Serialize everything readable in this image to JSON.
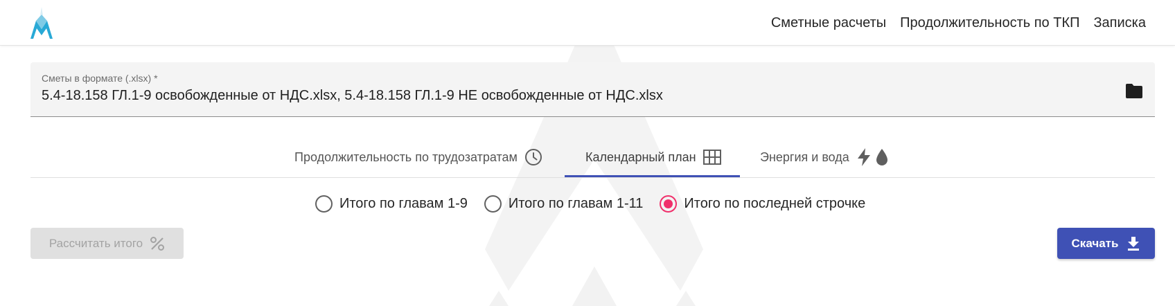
{
  "header": {
    "logo_icon": "company-logo",
    "nav": [
      "Сметные расчеты",
      "Продолжительность по ТКП",
      "Записка"
    ]
  },
  "file_field": {
    "label": "Сметы в формате (.xlsx) *",
    "value": "5.4-18.158 ГЛ.1-9 освобожденные от НДС.xlsx, 5.4-18.158 ГЛ.1-9 НЕ освобожденные от НДС.xlsx",
    "icon": "folder-icon"
  },
  "tabs": [
    {
      "label": "Продолжительность по трудозатратам",
      "icon": "clock-icon",
      "active": false
    },
    {
      "label": "Календарный план",
      "icon": "grid-icon",
      "active": true
    },
    {
      "label": "Энергия и вода",
      "icons": [
        "lightning-icon",
        "water-drop-icon"
      ],
      "active": false
    }
  ],
  "radio_options": [
    {
      "label": "Итого по главам 1-9",
      "checked": false
    },
    {
      "label": "Итого по главам 1-11",
      "checked": false
    },
    {
      "label": "Итого по последней строчке",
      "checked": true
    }
  ],
  "buttons": {
    "calculate_label": "Рассчитать итого",
    "calculate_icon": "percent-icon",
    "calculate_disabled": true,
    "download_label": "Скачать",
    "download_icon": "download-icon"
  },
  "colors": {
    "primary": "#3f51b5",
    "accent": "#f0306b",
    "field_bg": "#f4f4f4",
    "disabled_bg": "#e0e0e0",
    "logo": "#29a9d6"
  }
}
